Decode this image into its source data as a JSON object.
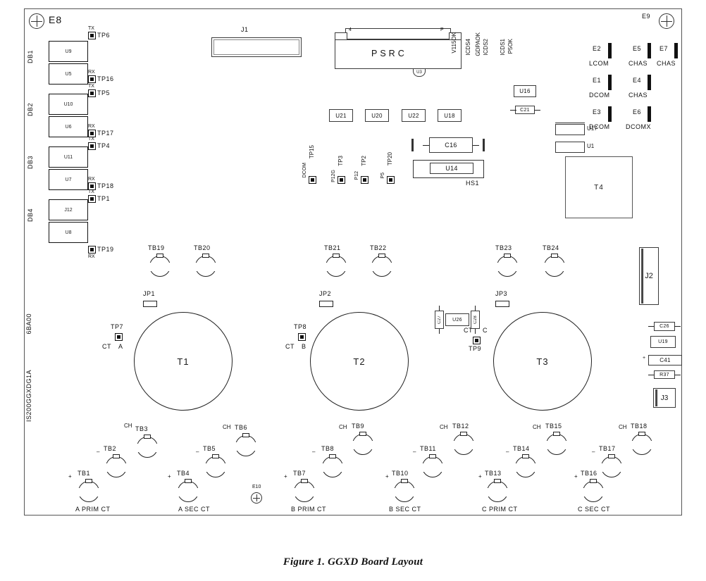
{
  "figure": {
    "caption": "Figure 1.  GGXD Board Layout"
  },
  "board": {
    "part_number": "IS200GGXDG1A",
    "rev_code": "6BA00",
    "corner_labels": {
      "top_left": "E8",
      "top_right": "E9"
    },
    "center_hole": "E10"
  },
  "db_connectors": [
    {
      "group": "DB1",
      "top_chip": "U9",
      "bottom_chip": "U5",
      "tx_label": "TX",
      "tx_tp": "TP6",
      "rx_label": "RX",
      "rx_tp": "TP16"
    },
    {
      "group": "DB2",
      "top_chip": "U10",
      "bottom_chip": "U6",
      "tx_label": "TX",
      "tx_tp": "TP5",
      "rx_label": "RX",
      "rx_tp": "TP17"
    },
    {
      "group": "DB3",
      "top_chip": "U11",
      "bottom_chip": "U7",
      "tx_label": "TX",
      "tx_tp": "TP4",
      "rx_label": "RX",
      "rx_tp": "TP18"
    },
    {
      "group": "DB4",
      "top_chip": "J12",
      "bottom_chip": "U8",
      "tx_label": "TX",
      "tx_tp": "TP1",
      "rx_label": "RX",
      "rx_tp": "TP19"
    }
  ],
  "top_components": {
    "j1_label": "J1",
    "psrc_label": "PSRC",
    "psrc_left_pin": "4",
    "psrc_right_pin": "P",
    "psrc_tab": "U3"
  },
  "status_labels": [
    "V115OK",
    "ICDS4",
    "GDPAOK",
    "ICDS2",
    "ICDS1",
    "P5OK"
  ],
  "e_studs": [
    {
      "id": "E2",
      "net": "LCOM"
    },
    {
      "id": "E5",
      "net": "CHAS"
    },
    {
      "id": "E7",
      "net": "CHAS"
    },
    {
      "id": "E1",
      "net": "DCOM"
    },
    {
      "id": "E4",
      "net": "CHAS"
    },
    {
      "id": "E3",
      "net": "DCOM"
    },
    {
      "id": "E6",
      "net": "DCOMX"
    }
  ],
  "ic_row": [
    "U21",
    "U20",
    "U22",
    "U18"
  ],
  "right_small": {
    "u16": "U16",
    "c21": "C21",
    "u17": "U17",
    "u1": "U1",
    "t4": "T4"
  },
  "mid_testpoints": [
    {
      "net": "DCOM",
      "tp": "TP15"
    },
    {
      "net": "P12G",
      "tp": "TP3"
    },
    {
      "net": "P12",
      "tp": "TP2"
    },
    {
      "net": "P5",
      "tp": "TP20"
    }
  ],
  "heatsink": {
    "c16": "C16",
    "u14": "U14",
    "hs1": "HS1"
  },
  "tb_top_row": [
    "TB19",
    "TB20",
    "TB21",
    "TB22",
    "TB23",
    "TB24"
  ],
  "jumpers": [
    "JP1",
    "JP2",
    "JP3"
  ],
  "transformers": [
    {
      "name": "T1",
      "tp": "TP7",
      "ct_label": "CT",
      "phase": "A"
    },
    {
      "name": "T2",
      "tp": "TP8",
      "ct_label": "CT",
      "phase": "B"
    },
    {
      "name": "T3",
      "tp": "TP9",
      "ct_label": "CT",
      "phase": "C"
    }
  ],
  "t3_network": {
    "c27": "C27",
    "u26": "U26",
    "c28": "C28"
  },
  "right_edge": {
    "j2": "J2",
    "c26": "C26",
    "u19": "U19",
    "c41": "C41",
    "c41_polarity": "+",
    "r37": "R37",
    "j3": "J3"
  },
  "bottom_terminal_groups": [
    {
      "group_label": "A PRIM CT",
      "terminals": [
        {
          "sign": "+",
          "id": "TB1"
        },
        {
          "sign": "–",
          "id": "TB2"
        },
        {
          "sign": "CH",
          "id": "TB3"
        }
      ]
    },
    {
      "group_label": "A SEC CT",
      "terminals": [
        {
          "sign": "+",
          "id": "TB4"
        },
        {
          "sign": "–",
          "id": "TB5"
        },
        {
          "sign": "CH",
          "id": "TB6"
        }
      ]
    },
    {
      "group_label": "B PRIM CT",
      "terminals": [
        {
          "sign": "+",
          "id": "TB7"
        },
        {
          "sign": "–",
          "id": "TB8"
        },
        {
          "sign": "CH",
          "id": "TB9"
        }
      ]
    },
    {
      "group_label": "B SEC CT",
      "terminals": [
        {
          "sign": "+",
          "id": "TB10"
        },
        {
          "sign": "–",
          "id": "TB11"
        },
        {
          "sign": "CH",
          "id": "TB12"
        }
      ]
    },
    {
      "group_label": "C PRIM CT",
      "terminals": [
        {
          "sign": "+",
          "id": "TB13"
        },
        {
          "sign": "–",
          "id": "TB14"
        },
        {
          "sign": "CH",
          "id": "TB15"
        }
      ]
    },
    {
      "group_label": "C SEC CT",
      "terminals": [
        {
          "sign": "+",
          "id": "TB16"
        },
        {
          "sign": "–",
          "id": "TB17"
        },
        {
          "sign": "CH",
          "id": "TB18"
        }
      ]
    }
  ]
}
